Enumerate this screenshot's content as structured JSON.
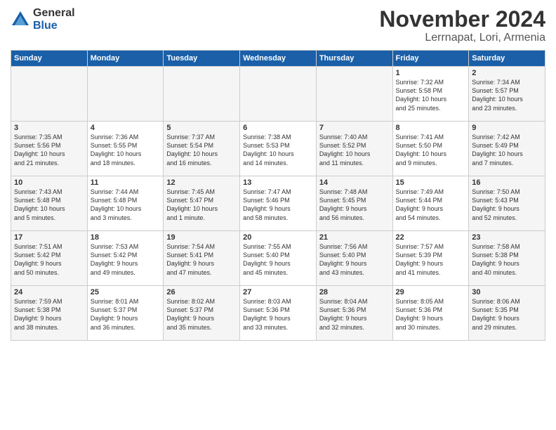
{
  "logo": {
    "general": "General",
    "blue": "Blue"
  },
  "title": "November 2024",
  "location": "Lerrnapat, Lori, Armenia",
  "headers": [
    "Sunday",
    "Monday",
    "Tuesday",
    "Wednesday",
    "Thursday",
    "Friday",
    "Saturday"
  ],
  "weeks": [
    {
      "days": [
        {
          "num": "",
          "info": ""
        },
        {
          "num": "",
          "info": ""
        },
        {
          "num": "",
          "info": ""
        },
        {
          "num": "",
          "info": ""
        },
        {
          "num": "",
          "info": ""
        },
        {
          "num": "1",
          "info": "Sunrise: 7:32 AM\nSunset: 5:58 PM\nDaylight: 10 hours\nand 25 minutes."
        },
        {
          "num": "2",
          "info": "Sunrise: 7:34 AM\nSunset: 5:57 PM\nDaylight: 10 hours\nand 23 minutes."
        }
      ]
    },
    {
      "days": [
        {
          "num": "3",
          "info": "Sunrise: 7:35 AM\nSunset: 5:56 PM\nDaylight: 10 hours\nand 21 minutes."
        },
        {
          "num": "4",
          "info": "Sunrise: 7:36 AM\nSunset: 5:55 PM\nDaylight: 10 hours\nand 18 minutes."
        },
        {
          "num": "5",
          "info": "Sunrise: 7:37 AM\nSunset: 5:54 PM\nDaylight: 10 hours\nand 16 minutes."
        },
        {
          "num": "6",
          "info": "Sunrise: 7:38 AM\nSunset: 5:53 PM\nDaylight: 10 hours\nand 14 minutes."
        },
        {
          "num": "7",
          "info": "Sunrise: 7:40 AM\nSunset: 5:52 PM\nDaylight: 10 hours\nand 11 minutes."
        },
        {
          "num": "8",
          "info": "Sunrise: 7:41 AM\nSunset: 5:50 PM\nDaylight: 10 hours\nand 9 minutes."
        },
        {
          "num": "9",
          "info": "Sunrise: 7:42 AM\nSunset: 5:49 PM\nDaylight: 10 hours\nand 7 minutes."
        }
      ]
    },
    {
      "days": [
        {
          "num": "10",
          "info": "Sunrise: 7:43 AM\nSunset: 5:48 PM\nDaylight: 10 hours\nand 5 minutes."
        },
        {
          "num": "11",
          "info": "Sunrise: 7:44 AM\nSunset: 5:48 PM\nDaylight: 10 hours\nand 3 minutes."
        },
        {
          "num": "12",
          "info": "Sunrise: 7:45 AM\nSunset: 5:47 PM\nDaylight: 10 hours\nand 1 minute."
        },
        {
          "num": "13",
          "info": "Sunrise: 7:47 AM\nSunset: 5:46 PM\nDaylight: 9 hours\nand 58 minutes."
        },
        {
          "num": "14",
          "info": "Sunrise: 7:48 AM\nSunset: 5:45 PM\nDaylight: 9 hours\nand 56 minutes."
        },
        {
          "num": "15",
          "info": "Sunrise: 7:49 AM\nSunset: 5:44 PM\nDaylight: 9 hours\nand 54 minutes."
        },
        {
          "num": "16",
          "info": "Sunrise: 7:50 AM\nSunset: 5:43 PM\nDaylight: 9 hours\nand 52 minutes."
        }
      ]
    },
    {
      "days": [
        {
          "num": "17",
          "info": "Sunrise: 7:51 AM\nSunset: 5:42 PM\nDaylight: 9 hours\nand 50 minutes."
        },
        {
          "num": "18",
          "info": "Sunrise: 7:53 AM\nSunset: 5:42 PM\nDaylight: 9 hours\nand 49 minutes."
        },
        {
          "num": "19",
          "info": "Sunrise: 7:54 AM\nSunset: 5:41 PM\nDaylight: 9 hours\nand 47 minutes."
        },
        {
          "num": "20",
          "info": "Sunrise: 7:55 AM\nSunset: 5:40 PM\nDaylight: 9 hours\nand 45 minutes."
        },
        {
          "num": "21",
          "info": "Sunrise: 7:56 AM\nSunset: 5:40 PM\nDaylight: 9 hours\nand 43 minutes."
        },
        {
          "num": "22",
          "info": "Sunrise: 7:57 AM\nSunset: 5:39 PM\nDaylight: 9 hours\nand 41 minutes."
        },
        {
          "num": "23",
          "info": "Sunrise: 7:58 AM\nSunset: 5:38 PM\nDaylight: 9 hours\nand 40 minutes."
        }
      ]
    },
    {
      "days": [
        {
          "num": "24",
          "info": "Sunrise: 7:59 AM\nSunset: 5:38 PM\nDaylight: 9 hours\nand 38 minutes."
        },
        {
          "num": "25",
          "info": "Sunrise: 8:01 AM\nSunset: 5:37 PM\nDaylight: 9 hours\nand 36 minutes."
        },
        {
          "num": "26",
          "info": "Sunrise: 8:02 AM\nSunset: 5:37 PM\nDaylight: 9 hours\nand 35 minutes."
        },
        {
          "num": "27",
          "info": "Sunrise: 8:03 AM\nSunset: 5:36 PM\nDaylight: 9 hours\nand 33 minutes."
        },
        {
          "num": "28",
          "info": "Sunrise: 8:04 AM\nSunset: 5:36 PM\nDaylight: 9 hours\nand 32 minutes."
        },
        {
          "num": "29",
          "info": "Sunrise: 8:05 AM\nSunset: 5:36 PM\nDaylight: 9 hours\nand 30 minutes."
        },
        {
          "num": "30",
          "info": "Sunrise: 8:06 AM\nSunset: 5:35 PM\nDaylight: 9 hours\nand 29 minutes."
        }
      ]
    }
  ],
  "col_classes": [
    "col-sun",
    "col-mon",
    "col-tue",
    "col-wed",
    "col-thu",
    "col-fri",
    "col-sat"
  ]
}
